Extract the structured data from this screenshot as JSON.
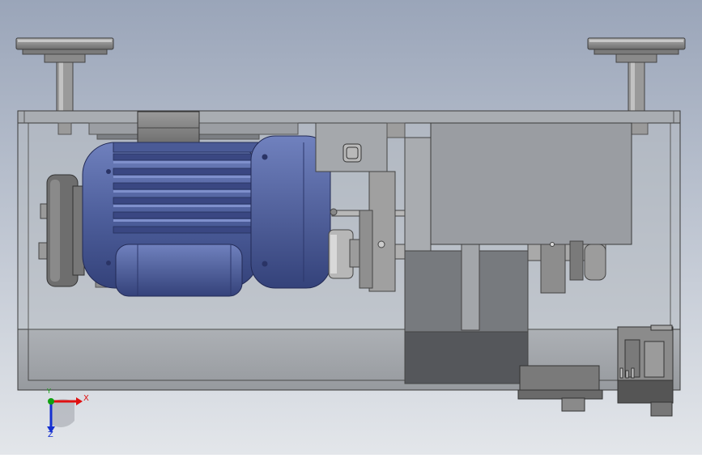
{
  "view": {
    "background_top": "#9aa5b9",
    "background_bottom": "#e3e6ea"
  },
  "colors": {
    "motor_blue": "#4e5f9c",
    "motor_blue_dark": "#2f3c6e",
    "motor_blue_light": "#7485c0",
    "housing_outline": "#3a3a3a",
    "steel_gray": "#8c8c8c",
    "dark_gray": "#6a6a6a"
  },
  "triad": {
    "x_label": "X",
    "y_label": "Y",
    "z_label": "Z",
    "x_color": "#e01010",
    "y_color": "#10a010",
    "z_color": "#1530d0"
  }
}
